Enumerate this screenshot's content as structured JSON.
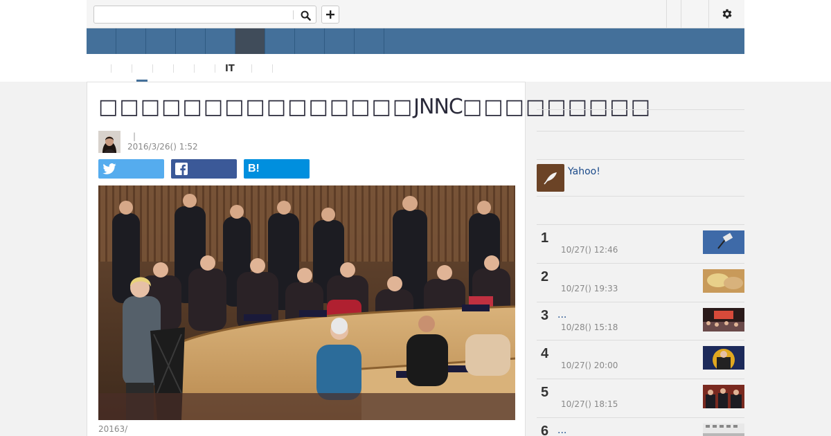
{
  "header": {
    "search_placeholder": "",
    "search_value": ""
  },
  "nav": {
    "tabs": [
      "",
      "",
      "",
      "",
      "",
      "",
      "",
      "",
      "",
      ""
    ],
    "active_index": 5
  },
  "subnav": {
    "items": [
      "",
      "",
      "",
      "",
      "",
      "IT",
      "",
      ""
    ]
  },
  "article": {
    "title": "JNNC",
    "byline_separator": "|",
    "date": "2016/3/26() 1:52",
    "share": {
      "twitter_icon": "twitter-icon",
      "facebook_icon": "facebook-icon",
      "hatena_label": "B!"
    },
    "photo_caption": "20163/"
  },
  "sidebar": {
    "yahoo_label": "Yahoo!",
    "ranking": [
      {
        "rank": "1",
        "title": "",
        "time": "10/27() 12:46"
      },
      {
        "rank": "2",
        "title": "",
        "time": "10/27() 19:33"
      },
      {
        "rank": "3",
        "title": "...",
        "time": "10/28() 15:18"
      },
      {
        "rank": "4",
        "title": "",
        "time": "10/27() 20:00"
      },
      {
        "rank": "5",
        "title": "",
        "time": "10/27() 18:15"
      },
      {
        "rank": "6",
        "title": "...",
        "time": ""
      }
    ]
  },
  "colors": {
    "nav_blue": "#44709a",
    "nav_active": "#404c5a",
    "twitter": "#55acee",
    "facebook": "#3b5998",
    "hatena": "#008fde",
    "link": "#1b4a8a"
  }
}
